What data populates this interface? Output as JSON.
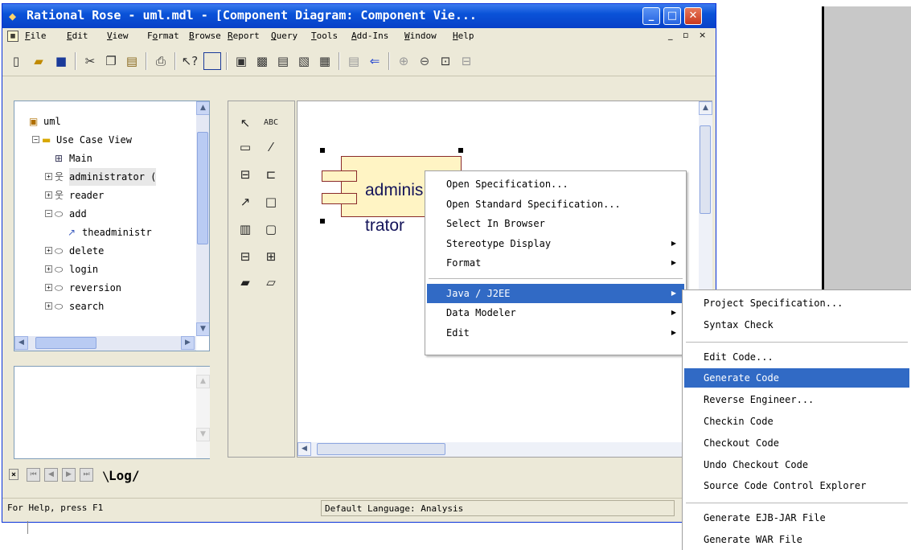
{
  "window": {
    "title": "Rational Rose - uml.mdl - [Component Diagram: Component Vie...",
    "controls": {
      "minimize": "_",
      "maximize": "□",
      "close": "✕"
    }
  },
  "menubar": {
    "items": [
      "File",
      "Edit",
      "View",
      "Format",
      "Browse",
      "Report",
      "Query",
      "Tools",
      "Add-Ins",
      "Window",
      "Help"
    ],
    "mnemonics": [
      "F",
      "E",
      "V",
      "o",
      "B",
      "R",
      "Q",
      "T",
      "A",
      "W",
      "H"
    ],
    "child_controls": [
      "_",
      "▫",
      "×"
    ]
  },
  "toolbar": {
    "icons": [
      "new-icon",
      "open-icon",
      "save-icon",
      "cut-icon",
      "copy-icon",
      "paste-icon",
      "print-icon",
      "context-help-icon",
      "view-doc-icon",
      "browse-class-icon",
      "browse-interaction-icon",
      "browse-component-icon",
      "browse-deployment-icon",
      "browse-parent-icon",
      "browse-previous-icon",
      "zoom-in-icon",
      "zoom-out-icon",
      "fit-window-icon",
      "undo-fit-icon"
    ]
  },
  "tree": {
    "items": [
      {
        "label": "uml",
        "level": 0,
        "icon": "model-icon",
        "expander": ""
      },
      {
        "label": "Use Case View",
        "level": 1,
        "icon": "folder-icon",
        "expander": "−"
      },
      {
        "label": "Main",
        "level": 2,
        "icon": "diagram-icon",
        "expander": ""
      },
      {
        "label": "administrator (",
        "level": 2,
        "icon": "actor-icon",
        "expander": "+",
        "selected": true
      },
      {
        "label": "reader",
        "level": 2,
        "icon": "actor-icon",
        "expander": "+"
      },
      {
        "label": "add",
        "level": 2,
        "icon": "usecase-icon",
        "expander": "−"
      },
      {
        "label": "theadministr",
        "level": 3,
        "icon": "association-icon",
        "expander": ""
      },
      {
        "label": "delete",
        "level": 2,
        "icon": "usecase-icon",
        "expander": "+"
      },
      {
        "label": "login",
        "level": 2,
        "icon": "usecase-icon",
        "expander": "+"
      },
      {
        "label": "reversion",
        "level": 2,
        "icon": "usecase-icon",
        "expander": "+"
      },
      {
        "label": "search",
        "level": 2,
        "icon": "usecase-icon",
        "expander": "+"
      }
    ]
  },
  "palette": {
    "tools": [
      "selection-icon",
      "text-icon",
      "note-icon",
      "anchor-note-icon",
      "component-icon",
      "package-icon",
      "dependency-icon",
      "subprogram-spec-icon",
      "main-program-icon",
      "subprogram-body-icon",
      "package-spec-icon",
      "package-body-icon",
      "task-spec-icon",
      "task-body-icon"
    ],
    "text_tool_label": "ABC"
  },
  "diagram": {
    "component_name": "administrator"
  },
  "context_menu": {
    "items": [
      {
        "label": "Open Specification...",
        "submenu": false
      },
      {
        "label": "Open Standard Specification...",
        "submenu": false
      },
      {
        "label": "Select In Browser",
        "submenu": false
      },
      {
        "label": "Stereotype Display",
        "submenu": true
      },
      {
        "label": "Format",
        "submenu": true
      },
      {
        "separator": true
      },
      {
        "label": "Java / J2EE",
        "submenu": true,
        "selected": true
      },
      {
        "label": "Data Modeler",
        "submenu": true
      },
      {
        "label": "Edit",
        "submenu": true
      }
    ]
  },
  "submenu": {
    "items": [
      {
        "label": "Project Specification..."
      },
      {
        "label": "Syntax Check"
      },
      {
        "separator": true
      },
      {
        "label": "Edit Code..."
      },
      {
        "label": "Generate Code",
        "selected": true
      },
      {
        "label": "Reverse Engineer..."
      },
      {
        "label": "Checkin Code"
      },
      {
        "label": "Checkout Code"
      },
      {
        "label": "Undo Checkout Code"
      },
      {
        "label": "Source Code Control Explorer"
      },
      {
        "separator": true
      },
      {
        "label": "Generate EJB-JAR File"
      },
      {
        "label": "Generate WAR File"
      }
    ]
  },
  "tabs": {
    "log": "Log"
  },
  "statusbar": {
    "help": "For Help, press F1",
    "language": "Default Language: Analysis"
  },
  "colors": {
    "title_blue": "#0a53d8",
    "menu_highlight": "#316ac5",
    "component_fill": "#fff4c4",
    "component_border": "#8a2a2a"
  }
}
